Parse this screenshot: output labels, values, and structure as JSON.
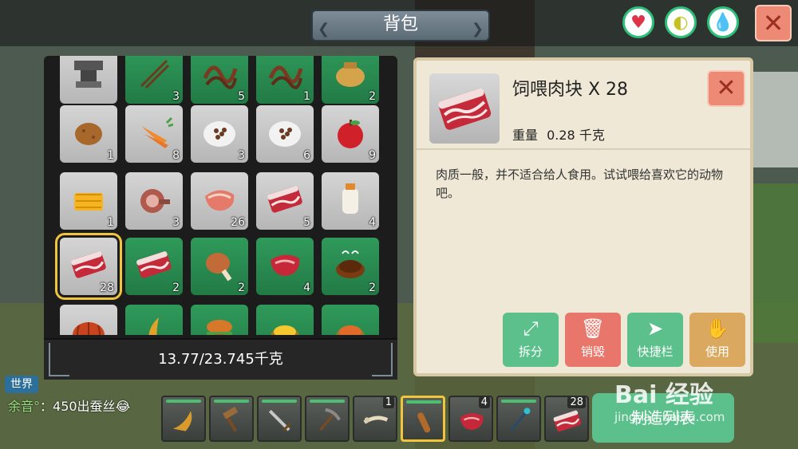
{
  "window": {
    "title": "背包",
    "close_label": "✕"
  },
  "status_buttons": [
    {
      "name": "heart-status-icon",
      "glyph": "♥",
      "color": "#e0334a"
    },
    {
      "name": "stomach-status-icon",
      "glyph": "◐",
      "color": "#c4c21f"
    },
    {
      "name": "water-status-icon",
      "glyph": "💧",
      "color": "#1a9aa8"
    }
  ],
  "inventory": {
    "rows": [
      [
        {
          "item": "anvil",
          "count": "",
          "bg": "gray"
        },
        {
          "item": "chopsticks",
          "count": "3",
          "bg": "green"
        },
        {
          "item": "rope",
          "count": "5",
          "bg": "green"
        },
        {
          "item": "rope",
          "count": "1",
          "bg": "green"
        },
        {
          "item": "sack",
          "count": "2",
          "bg": "green"
        }
      ],
      [
        {
          "item": "potato",
          "count": "1",
          "bg": "gray"
        },
        {
          "item": "carrot",
          "count": "8",
          "bg": "gray"
        },
        {
          "item": "seeds-plate",
          "count": "3",
          "bg": "gray"
        },
        {
          "item": "seeds-plate",
          "count": "6",
          "bg": "gray"
        },
        {
          "item": "apple",
          "count": "9",
          "bg": "gray"
        }
      ],
      [
        {
          "item": "honeycomb",
          "count": "1",
          "bg": "gray"
        },
        {
          "item": "ham",
          "count": "3",
          "bg": "gray"
        },
        {
          "item": "steak",
          "count": "26",
          "bg": "gray"
        },
        {
          "item": "raw-meat",
          "count": "5",
          "bg": "gray"
        },
        {
          "item": "milk",
          "count": "4",
          "bg": "gray"
        }
      ],
      [
        {
          "item": "raw-meat",
          "count": "28",
          "bg": "gray",
          "selected": true
        },
        {
          "item": "raw-meat",
          "count": "2",
          "bg": "green"
        },
        {
          "item": "drumstick",
          "count": "2",
          "bg": "green"
        },
        {
          "item": "steak-red",
          "count": "4",
          "bg": "green"
        },
        {
          "item": "cooked-dish",
          "count": "2",
          "bg": "green"
        }
      ],
      [
        {
          "item": "pumpkin",
          "count": "",
          "bg": "gray"
        },
        {
          "item": "horn",
          "count": "",
          "bg": "green"
        },
        {
          "item": "burger",
          "count": "",
          "bg": "green"
        },
        {
          "item": "gold-sack",
          "count": "",
          "bg": "green"
        },
        {
          "item": "spice-sack",
          "count": "",
          "bg": "green"
        }
      ]
    ],
    "weight_text": "13.77/23.745千克"
  },
  "detail": {
    "name": "饲喂肉块 X 28",
    "weight_label": "重量",
    "weight_value": "0.28 千克",
    "description": "肉质一般，并不适合给人食用。试试喂给喜欢它的动物吧。",
    "close_label": "✕",
    "actions": [
      {
        "label": "拆分",
        "glyph": "⤢",
        "style": "act-green",
        "name": "split-button",
        "icon": "expand-icon"
      },
      {
        "label": "销毁",
        "glyph": "🗑",
        "style": "act-red",
        "name": "destroy-button",
        "icon": "trash-icon"
      },
      {
        "label": "快捷栏",
        "glyph": "➤",
        "style": "act-green",
        "name": "hotbar-button",
        "icon": "arrow-icon"
      },
      {
        "label": "使用",
        "glyph": "✋",
        "style": "act-gold",
        "name": "use-button",
        "icon": "hand-icon"
      }
    ]
  },
  "chat": {
    "channel": "世界",
    "speaker": "余音°",
    "message": "：450出蚕丝",
    "emoji": "😂"
  },
  "hotbar": [
    {
      "item": "horn-gold",
      "count": "",
      "dur": true
    },
    {
      "item": "hammer",
      "count": "",
      "dur": true
    },
    {
      "item": "sword",
      "count": "",
      "dur": true
    },
    {
      "item": "pickaxe",
      "count": "",
      "dur": true
    },
    {
      "item": "bone-club",
      "count": "1",
      "dur": false
    },
    {
      "item": "club",
      "count": "",
      "dur": true,
      "selected": true
    },
    {
      "item": "steak-red",
      "count": "4",
      "dur": false
    },
    {
      "item": "staff",
      "count": "",
      "dur": true
    },
    {
      "item": "raw-meat",
      "count": "28",
      "dur": false
    }
  ],
  "craft_button": "制造列表",
  "watermark": {
    "brand": "Bai 经验",
    "url": "jingyan.baidu.com"
  },
  "colors": {
    "accent_green": "#5cc08c",
    "close_red": "#ec8a76",
    "select_gold": "#f0c53c"
  }
}
